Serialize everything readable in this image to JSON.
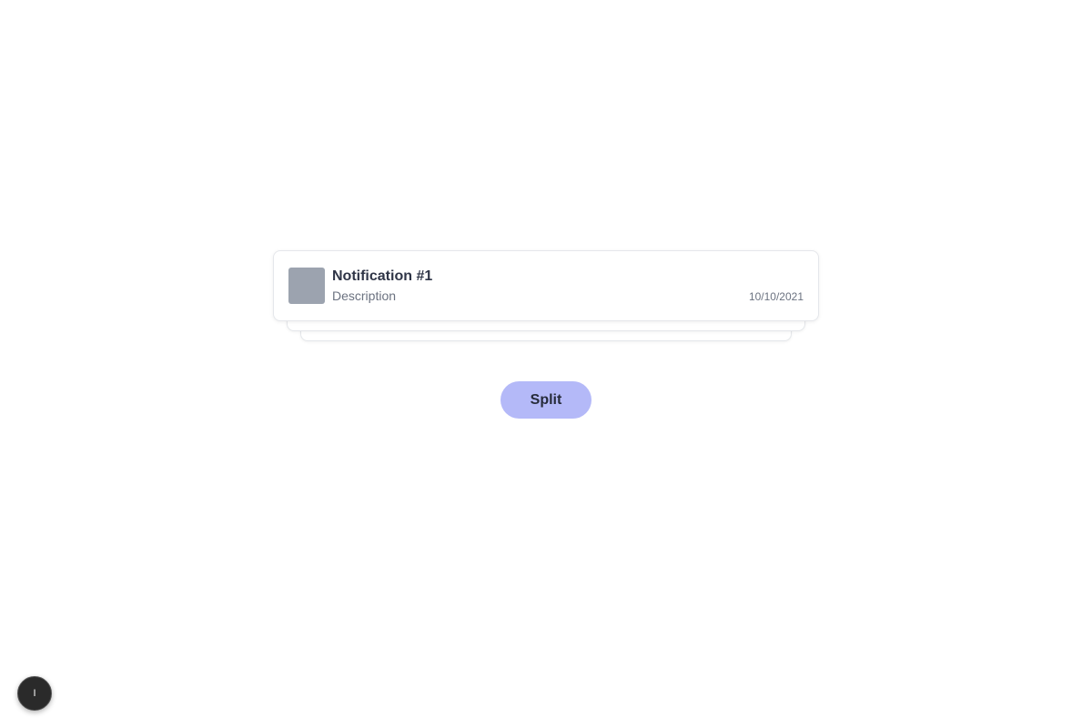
{
  "notification": {
    "title": "Notification #1",
    "description": "Description",
    "date": "10/10/2021",
    "thumbnail_color": "#9ca3af"
  },
  "split_button": {
    "label": "Split",
    "color": "#b4b9f8"
  },
  "fab": {
    "label": "I"
  }
}
